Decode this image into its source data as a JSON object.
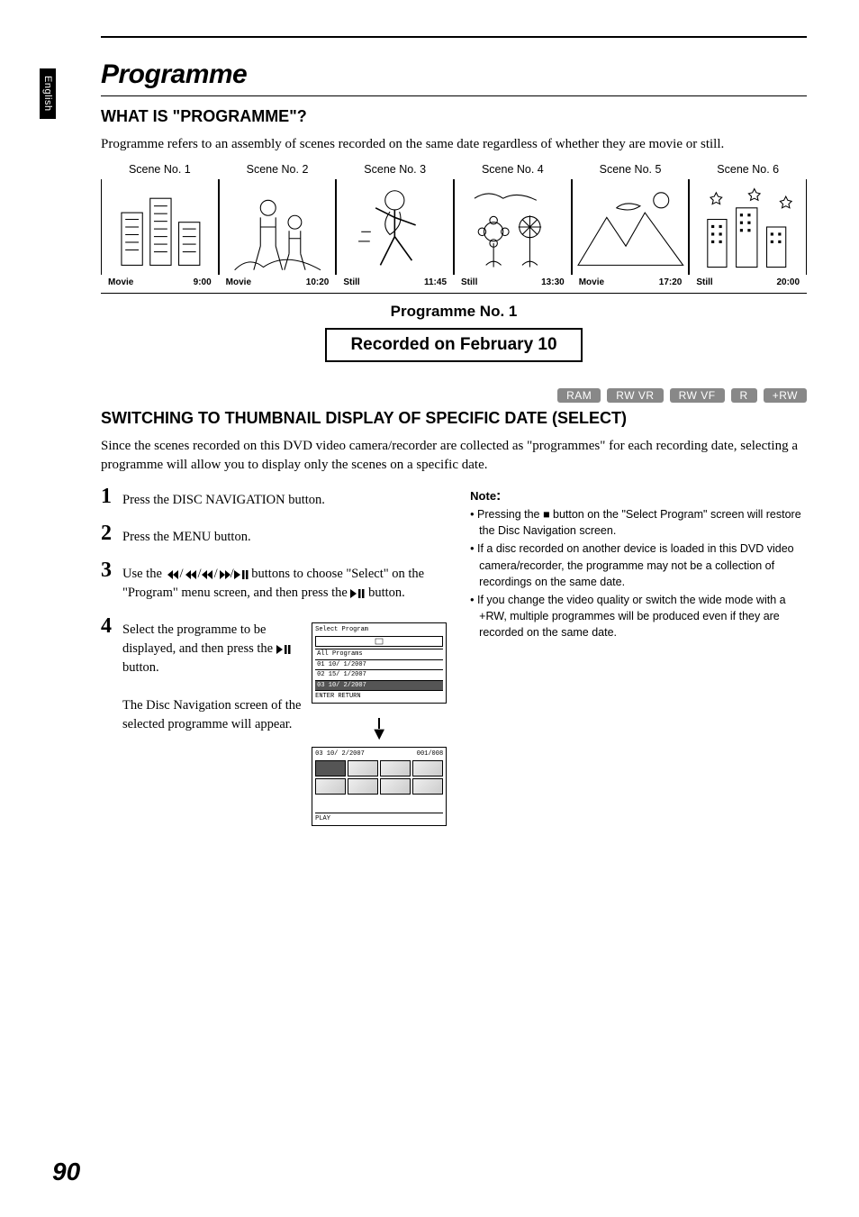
{
  "lang_tab": "English",
  "title": "Programme",
  "section1": {
    "heading": "WHAT IS \"PROGRAMME\"?",
    "body": "Programme refers to an assembly of scenes recorded on the same date regardless of whether they are movie or still."
  },
  "scenes": [
    {
      "label": "Scene No. 1",
      "type": "Movie",
      "time": "9:00"
    },
    {
      "label": "Scene No. 2",
      "type": "Movie",
      "time": "10:20"
    },
    {
      "label": "Scene No. 3",
      "type": "Still",
      "time": "11:45"
    },
    {
      "label": "Scene No. 4",
      "type": "Still",
      "time": "13:30"
    },
    {
      "label": "Scene No. 5",
      "type": "Movie",
      "time": "17:20"
    },
    {
      "label": "Scene No. 6",
      "type": "Still",
      "time": "20:00"
    }
  ],
  "programme_block": {
    "title": "Programme No. 1",
    "recorded": "Recorded on February 10"
  },
  "badges": [
    "RAM",
    "RW VR",
    "RW VF",
    "R",
    "+RW"
  ],
  "section2": {
    "heading": "SWITCHING TO THUMBNAIL DISPLAY OF SPECIFIC DATE (SELECT)",
    "body": "Since the scenes recorded on this DVD video camera/recorder are collected as \"programmes\" for each recording date, selecting a programme will allow you to display only the scenes on a specific date."
  },
  "steps": {
    "s1": "Press the DISC NAVIGATION button.",
    "s2": "Press the MENU button.",
    "s3_pre": "Use the ",
    "s3_mid": " buttons to choose \"Select\" on the \"Program\" menu screen, and then press the ",
    "s3_post": " button.",
    "s4a": "Select the programme to be displayed, and then press the ",
    "s4a2": " button.",
    "s4b": "The Disc Navigation screen of the selected programme will appear."
  },
  "notes": {
    "head": "Note",
    "items": [
      "Pressing the ■ button on the \"Select Program\" screen will restore the Disc Navigation screen.",
      "If a disc recorded on another device is loaded in this DVD video camera/recorder, the programme may not be a collection of recordings on the same date.",
      "If you change the video quality or switch the wide mode with a +RW, multiple programmes will be produced even if they are recorded on the same date."
    ]
  },
  "ui_screen1": {
    "title": "Select Program",
    "rows": [
      "All Programs",
      "01 10/ 1/2007",
      "02 15/ 1/2007",
      "03 10/ 2/2007"
    ],
    "buttons": "ENTER   RETURN"
  },
  "ui_screen2": {
    "hdr_l": "03  10/ 2/2007",
    "hdr_r": "001/008",
    "ftr_l": "PLAY",
    "ftr_r": ""
  },
  "page_number": "90"
}
